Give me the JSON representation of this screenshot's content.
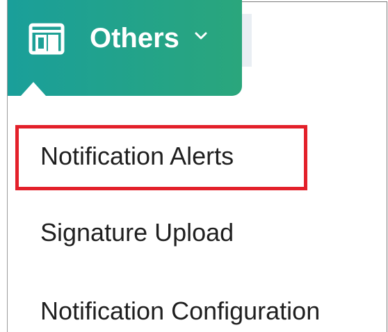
{
  "menu": {
    "trigger_label": "Others",
    "icon": "panel-icon",
    "chevron": "chevron-down-icon",
    "accent_color": "#1f9f8f"
  },
  "items": [
    {
      "label": "Notification Alerts",
      "highlighted": true
    },
    {
      "label": "Signature Upload",
      "highlighted": false
    },
    {
      "label": "Notification Configuration",
      "highlighted": false
    }
  ],
  "highlight_color": "#e3202a"
}
